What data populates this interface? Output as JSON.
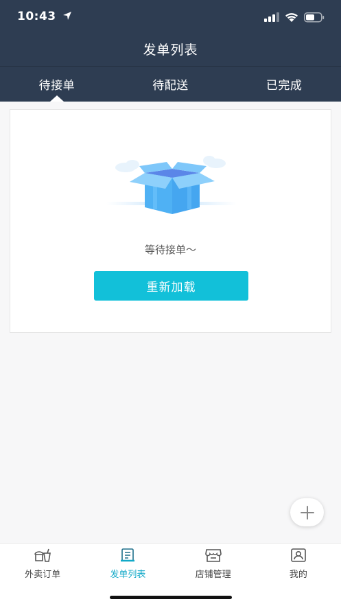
{
  "status_bar": {
    "time": "10:43"
  },
  "nav": {
    "title": "发单列表"
  },
  "tabs": [
    {
      "label": "待接单",
      "active": true
    },
    {
      "label": "待配送",
      "active": false
    },
    {
      "label": "已完成",
      "active": false
    }
  ],
  "empty_state": {
    "message": "等待接单～",
    "reload_label": "重新加载"
  },
  "tabbar": {
    "items": [
      {
        "label": "外卖订单",
        "icon": "takeout-icon",
        "active": false
      },
      {
        "label": "发单列表",
        "icon": "order-list-icon",
        "active": true
      },
      {
        "label": "店铺管理",
        "icon": "shop-icon",
        "active": false
      },
      {
        "label": "我的",
        "icon": "profile-icon",
        "active": false
      }
    ]
  },
  "colors": {
    "header_bg": "#2e3d52",
    "accent": "#12c0d9",
    "tab_active": "#12a9c8"
  }
}
